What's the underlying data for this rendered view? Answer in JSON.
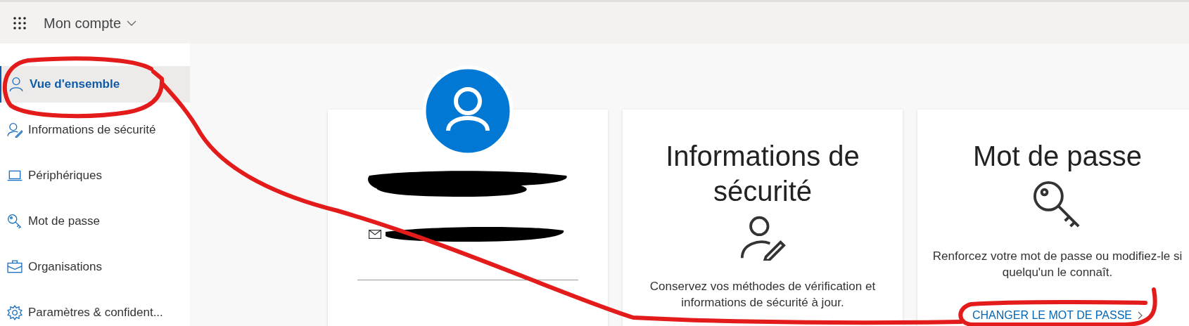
{
  "header": {
    "title": "Mon compte"
  },
  "sidebar": {
    "items": [
      {
        "label": "Vue d'ensemble",
        "selected": true
      },
      {
        "label": "Informations de sécurité",
        "selected": false
      },
      {
        "label": "Périphériques",
        "selected": false
      },
      {
        "label": "Mot de passe",
        "selected": false
      },
      {
        "label": "Organisations",
        "selected": false
      },
      {
        "label": "Paramètres & confident...",
        "selected": false
      }
    ]
  },
  "cards": [
    {
      "kind": "profile"
    },
    {
      "kind": "info",
      "title": "Informations de sécurité",
      "description": "Conservez vos méthodes de vérification et informations de sécurité à jour."
    },
    {
      "kind": "info",
      "title": "Mot de passe",
      "description": "Renforcez votre mot de passe ou modifiez-le si quelqu'un le connaît.",
      "link": "CHANGER LE MOT DE PASSE"
    }
  ]
}
